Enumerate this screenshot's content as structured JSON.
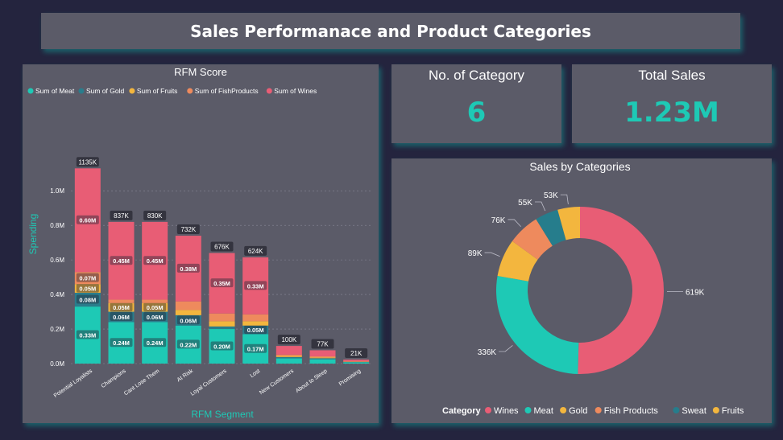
{
  "header": {
    "title": "Sales Performanace and Product Categories"
  },
  "kpis": {
    "category_label": "No. of Category",
    "category_value": "6",
    "sales_label": "Total Sales",
    "sales_value": "1.23M"
  },
  "colors": {
    "Meat": "#1ec9b5",
    "Gold": "#2a7d8c",
    "Fruits": "#f3b63e",
    "FishProducts": "#ee8a5d",
    "Wines": "#e85d75",
    "Sweat": "#267d8c"
  },
  "chart_data": [
    {
      "type": "bar",
      "stacked": true,
      "title": "RFM Score",
      "xlabel": "RFM Segment",
      "ylabel": "Spending",
      "ylim": [
        0,
        1.15
      ],
      "yticks": [
        "0.0M",
        "0.2M",
        "0.4M",
        "0.6M",
        "0.8M",
        "1.0M"
      ],
      "grid": true,
      "legend_position": "top-left",
      "categories": [
        "Potential Loyalists",
        "Champions",
        "Cant Lose Them",
        "At Risk",
        "Loyal Customers",
        "Lost",
        "New Customers",
        "About to Sleep",
        "Promising"
      ],
      "totals_labels": [
        "1135K",
        "837K",
        "830K",
        "732K",
        "676K",
        "624K",
        "100K",
        "77K",
        "21K"
      ],
      "series": [
        {
          "name": "Sum of Meat",
          "color": "#1ec9b5",
          "values": [
            0.33,
            0.24,
            0.24,
            0.22,
            0.2,
            0.17,
            0.03,
            0.025,
            0.007
          ],
          "labels": [
            "0.33M",
            "0.24M",
            "0.24M",
            "0.22M",
            "0.20M",
            "0.17M",
            "",
            "",
            ""
          ]
        },
        {
          "name": "Sum of Gold",
          "color": "#2a7d8c",
          "values": [
            0.08,
            0.06,
            0.06,
            0.06,
            0.015,
            0.05,
            0.008,
            0.006,
            0.002
          ],
          "labels": [
            "0.08M",
            "0.06M",
            "0.06M",
            "0.06M",
            "",
            "0.05M",
            "",
            "",
            ""
          ]
        },
        {
          "name": "Sum of Fruits",
          "color": "#f3b63e",
          "values": [
            0.05,
            0.05,
            0.05,
            0.03,
            0.03,
            0.025,
            0.006,
            0.005,
            0.002
          ],
          "labels": [
            "0.05M",
            "0.05M",
            "0.05M",
            "",
            "",
            "",
            "",
            "",
            ""
          ]
        },
        {
          "name": "Sum of FishProducts",
          "color": "#ee8a5d",
          "values": [
            0.07,
            0.02,
            0.02,
            0.05,
            0.045,
            0.04,
            0.008,
            0.006,
            0.002
          ],
          "labels": [
            "0.07M",
            "",
            "",
            "",
            "",
            "",
            "",
            "",
            ""
          ]
        },
        {
          "name": "Sum of Wines",
          "color": "#e85d75",
          "values": [
            0.6,
            0.45,
            0.45,
            0.38,
            0.35,
            0.33,
            0.05,
            0.035,
            0.01
          ],
          "labels": [
            "0.60M",
            "0.45M",
            "0.45M",
            "0.38M",
            "0.35M",
            "0.33M",
            "",
            "",
            ""
          ]
        }
      ]
    },
    {
      "type": "pie",
      "donut": true,
      "title": "Sales by Categories",
      "legend_title": "Category",
      "legend_position": "bottom",
      "categories": [
        "Wines",
        "Meat",
        "Gold",
        "Fish Products",
        "Sweat",
        "Fruits"
      ],
      "values": [
        619,
        336,
        89,
        76,
        55,
        53
      ],
      "labels": [
        "619K",
        "336K",
        "89K",
        "76K",
        "55K",
        "53K"
      ],
      "colors": [
        "#e85d75",
        "#1ec9b5",
        "#f3b63e",
        "#ee8a5d",
        "#267d8c",
        "#f3b63e"
      ]
    }
  ]
}
